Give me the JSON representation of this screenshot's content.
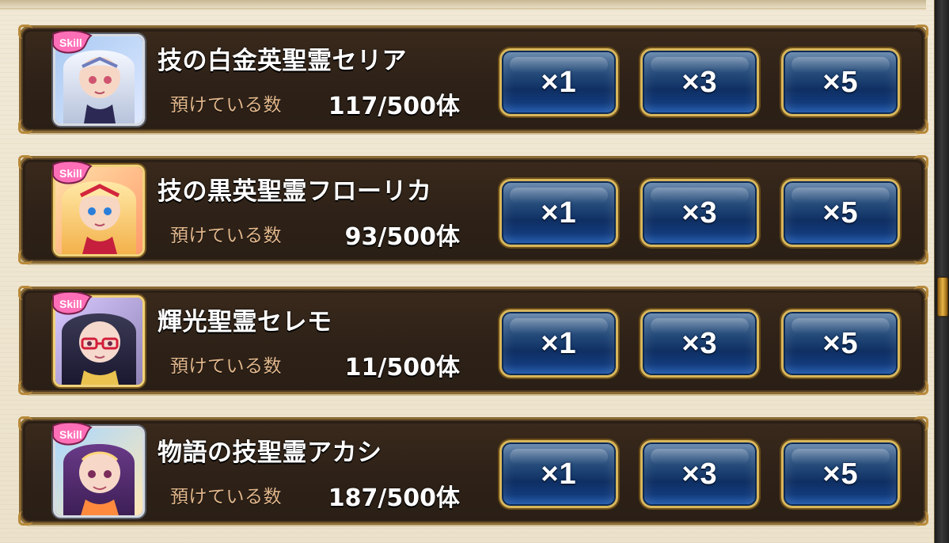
{
  "ui": {
    "deposit_label": "預けている数",
    "multiplier_buttons": [
      "×1",
      "×3",
      "×5"
    ],
    "colors": {
      "row_bg": "#2e2117",
      "row_border": "#8b6b35",
      "button_blue": "#1f4575",
      "button_border": "#d8b65c",
      "label_tan": "#e1b68b",
      "text_white": "#ffffff",
      "skill_badge_pink": "#ff6fb7"
    }
  },
  "items": [
    {
      "name": "技の白金英聖霊セリア",
      "count": "117/500体",
      "portrait": "character-portrait-silver-hair"
    },
    {
      "name": "技の黒英聖霊フローリカ",
      "count": "93/500体",
      "portrait": "character-portrait-blonde"
    },
    {
      "name": "輝光聖霊セレモ",
      "count": "11/500体",
      "portrait": "character-portrait-dark-hair-glasses"
    },
    {
      "name": "物語の技聖霊アカシ",
      "count": "187/500体",
      "portrait": "character-portrait-purple-hair"
    }
  ],
  "badge": {
    "text": "Skill"
  }
}
